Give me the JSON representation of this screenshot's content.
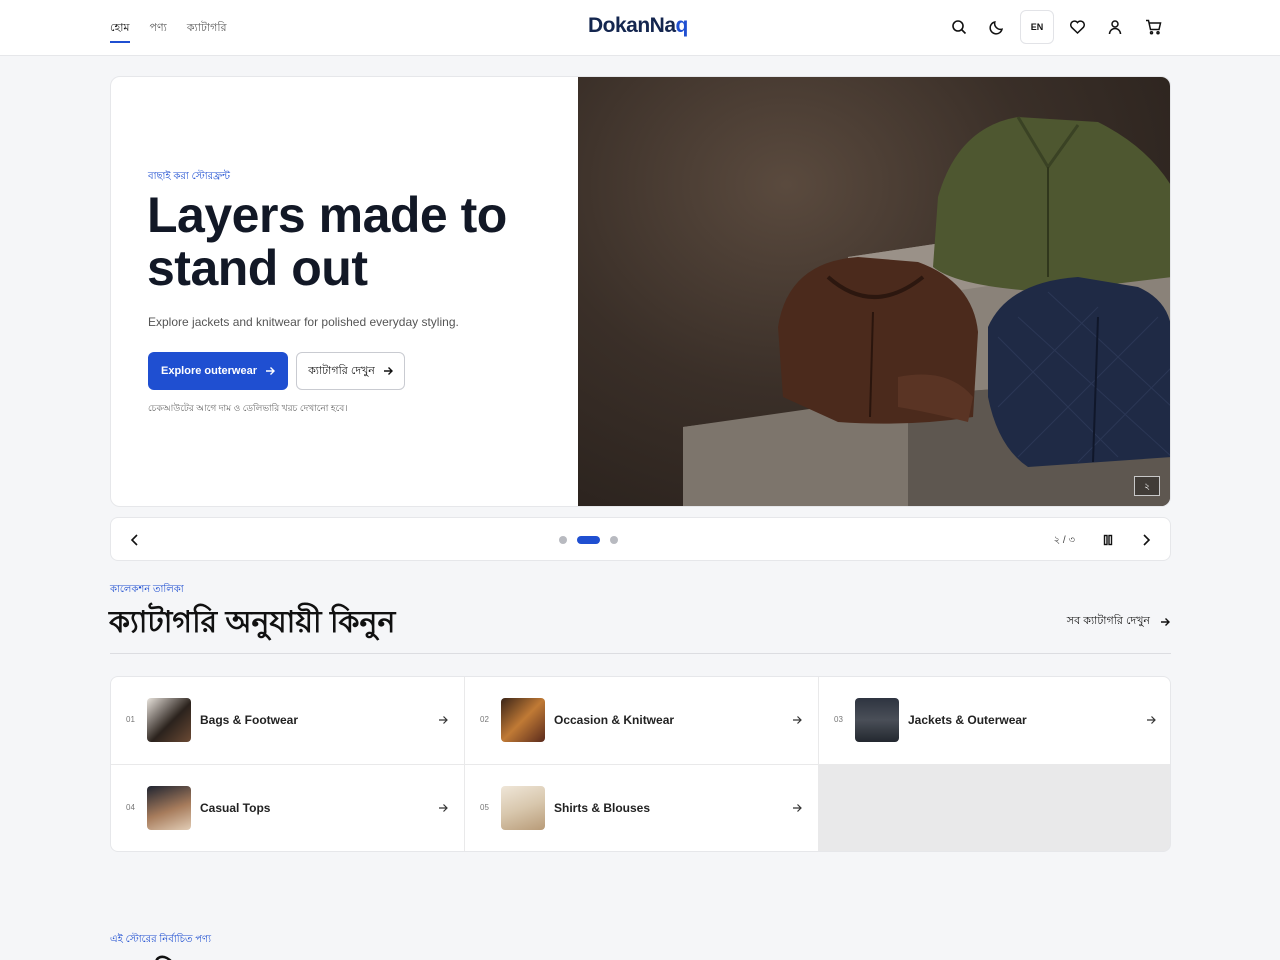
{
  "header": {
    "nav": [
      {
        "label": "হোম",
        "active": true
      },
      {
        "label": "পণ্য",
        "active": false
      },
      {
        "label": "ক্যাটাগরি",
        "active": false
      }
    ],
    "logo_main": "DokanNa",
    "logo_accent": "q",
    "lang_label": "EN",
    "icons": [
      "search-icon",
      "moon-icon",
      "heart-icon",
      "user-icon",
      "cart-icon"
    ]
  },
  "hero": {
    "eyebrow": "বাছাই করা স্টোরফ্রন্ট",
    "title": "Layers made to stand out",
    "description": "Explore jackets and knitwear for polished everyday styling.",
    "primary_button": "Explore outerwear",
    "secondary_button": "ক্যাটাগরি দেখুন",
    "note": "চেকআউটের আগে দাম ও ডেলিভারি খরচ দেখানো হবে।",
    "slide_badge": "২"
  },
  "carousel": {
    "slide_count": 3,
    "active_slide": 2,
    "counter": "২ / ৩"
  },
  "categories": {
    "eyebrow": "কালেকশন তালিকা",
    "title": "ক্যাটাগরি অনুযায়ী কিনুন",
    "see_all": "সব ক্যাটাগরি দেখুন",
    "items": [
      {
        "num": "01",
        "label": "Bags & Footwear",
        "thumb_color": "#5b3d2c"
      },
      {
        "num": "02",
        "label": "Occasion & Knitwear",
        "thumb_color": "#8a4a22"
      },
      {
        "num": "03",
        "label": "Jackets & Outerwear",
        "thumb_color": "#3f4550"
      },
      {
        "num": "04",
        "label": "Casual Tops",
        "thumb_color": "#7b5a40"
      },
      {
        "num": "05",
        "label": "Shirts & Blouses",
        "thumb_color": "#d9cdb7"
      }
    ]
  },
  "featured": {
    "eyebrow": "এই স্টোরের নির্বাচিত পণ্য",
    "title": "জনপ্রিয় পণ্য"
  },
  "colors": {
    "accent": "#1f4fd1",
    "text_dark": "#121826"
  }
}
